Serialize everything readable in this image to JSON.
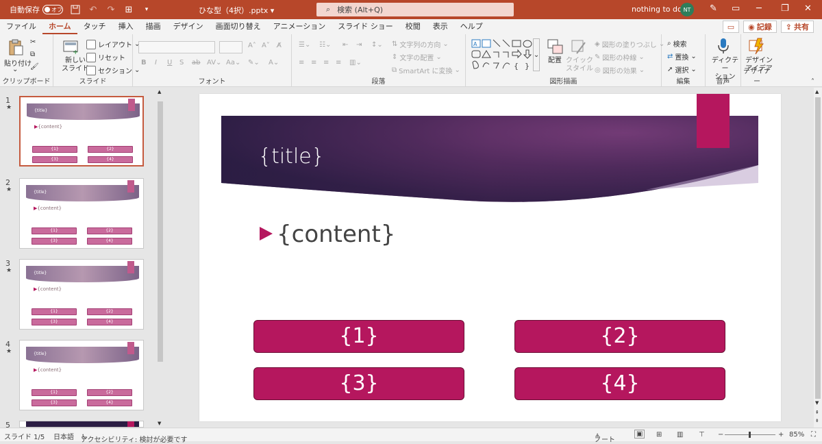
{
  "titlebar": {
    "autosave_label": "自動保存",
    "autosave_state": "オフ",
    "doc_title": "ひな型（4択）.pptx ▾",
    "search_placeholder": "検索 (Alt+Q)",
    "user_name": "nothing to do",
    "user_initials": "NT"
  },
  "menu": {
    "tabs": [
      "ファイル",
      "ホーム",
      "タッチ",
      "挿入",
      "描画",
      "デザイン",
      "画面切り替え",
      "アニメーション",
      "スライド ショー",
      "校閲",
      "表示",
      "ヘルプ"
    ],
    "active_tab": "ホーム",
    "record_label": "記録",
    "share_label": "共有"
  },
  "ribbon": {
    "clipboard": {
      "label": "クリップボード",
      "paste": "貼り付け"
    },
    "slide": {
      "label": "スライド",
      "new_slide": "新しい\nスライド",
      "layout": "レイアウト",
      "reset": "リセット",
      "section": "セクション"
    },
    "font": {
      "label": "フォント",
      "bold": "B",
      "italic": "I",
      "underline": "U",
      "strike": "S"
    },
    "paragraph": {
      "label": "段落",
      "text_direction": "文字列の方向",
      "align_text": "文字の配置",
      "smartart": "SmartArt に変換"
    },
    "drawing": {
      "label": "図形描画",
      "arrange": "配置",
      "quick_styles": "クイック\nスタイル",
      "shape_fill": "図形の塗りつぶし",
      "shape_outline": "図形の枠線",
      "shape_effects": "図形の効果"
    },
    "editing": {
      "label": "編集",
      "find": "検索",
      "replace": "置換",
      "select": "選択"
    },
    "voice": {
      "label": "音声",
      "dictate": "ディクテー\nション"
    },
    "designer": {
      "label": "デザイナー",
      "design_ideas": "デザイン\nアイデア"
    }
  },
  "thumbnails": [
    {
      "number": "1",
      "title": "{title}",
      "content": "{content}",
      "boxes": [
        "{1}",
        "{2}",
        "{3}",
        "{4}"
      ],
      "selected": true
    },
    {
      "number": "2",
      "title": "{title}",
      "content": "{content}",
      "boxes": [
        "{1}",
        "{2}",
        "{3}",
        "{4}"
      ],
      "selected": false
    },
    {
      "number": "3",
      "title": "{title}",
      "content": "{content}",
      "boxes": [
        "{1}",
        "{2}",
        "{3}",
        "{4}"
      ],
      "selected": false
    },
    {
      "number": "4",
      "title": "{title}",
      "content": "{content}",
      "boxes": [
        "{1}",
        "{2}",
        "{3}",
        "{4}"
      ],
      "selected": false
    },
    {
      "number": "5"
    }
  ],
  "slide": {
    "title": "{title}",
    "content": "{content}",
    "options": [
      "{1}",
      "{2}",
      "{3}",
      "{4}"
    ],
    "accent_color": "#b5175e"
  },
  "statusbar": {
    "slide_info": "スライド 1/5",
    "language": "日本語",
    "accessibility": "アクセシビリティ: 検討が必要です",
    "notes": "ノート",
    "zoom": "85%"
  }
}
